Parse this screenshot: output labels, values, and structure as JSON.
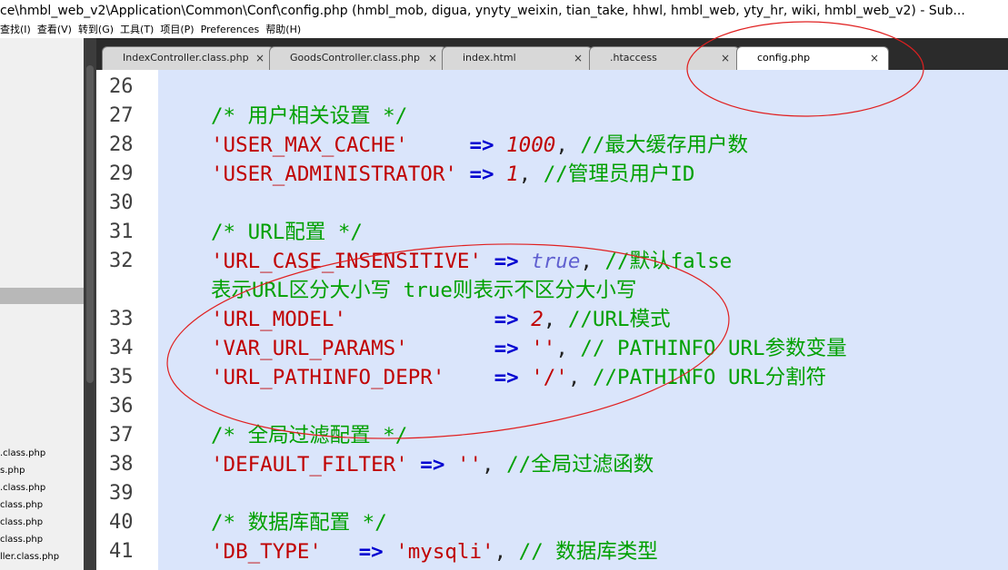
{
  "window": {
    "title": "ce\\hmbl_web_v2\\Application\\Common\\Conf\\config.php (hmbl_mob, digua, ynyty_weixin, tian_take, hhwl, hmbl_web, yty_hr, wiki, hmbl_web_v2) - Sub..."
  },
  "menu": [
    {
      "label": "查找(I)"
    },
    {
      "label": "查看(V)"
    },
    {
      "label": "转到(G)"
    },
    {
      "label": "工具(T)"
    },
    {
      "label": "项目(P)"
    },
    {
      "label": "Preferences"
    },
    {
      "label": "帮助(H)"
    }
  ],
  "sidebar": {
    "files": [
      {
        "name": ".class.php"
      },
      {
        "name": "s.php"
      },
      {
        "name": ".class.php"
      },
      {
        "name": "class.php"
      },
      {
        "name": "class.php"
      },
      {
        "name": "class.php"
      },
      {
        "name": "ller.class.php"
      }
    ]
  },
  "tabs": [
    {
      "label": "IndexController.class.php",
      "close": "×",
      "active": false
    },
    {
      "label": "GoodsController.class.php",
      "close": "×",
      "active": false
    },
    {
      "label": "index.html",
      "close": "×",
      "active": false
    },
    {
      "label": ".htaccess",
      "close": "×",
      "active": false
    },
    {
      "label": "config.php",
      "close": "×",
      "active": true
    }
  ],
  "editor": {
    "line_numbers": [
      "26",
      "27",
      "28",
      "29",
      "30",
      "31",
      "32",
      "",
      "33",
      "34",
      "35",
      "36",
      "37",
      "38",
      "39",
      "40",
      "41"
    ],
    "lines": [
      [],
      [
        {
          "t": "/* 用户相关设置 */",
          "c": "c-comment"
        }
      ],
      [
        {
          "t": "'USER_MAX_CACHE'",
          "c": "c-str"
        },
        {
          "t": "     ",
          "c": "c-plain"
        },
        {
          "t": "=>",
          "c": "c-op"
        },
        {
          "t": " ",
          "c": "c-plain"
        },
        {
          "t": "1000",
          "c": "c-num"
        },
        {
          "t": ", ",
          "c": "c-plain"
        },
        {
          "t": "//最大缓存用户数",
          "c": "c-comment"
        }
      ],
      [
        {
          "t": "'USER_ADMINISTRATOR'",
          "c": "c-str"
        },
        {
          "t": " ",
          "c": "c-plain"
        },
        {
          "t": "=>",
          "c": "c-op"
        },
        {
          "t": " ",
          "c": "c-plain"
        },
        {
          "t": "1",
          "c": "c-num"
        },
        {
          "t": ", ",
          "c": "c-plain"
        },
        {
          "t": "//管理员用户ID",
          "c": "c-comment"
        }
      ],
      [],
      [
        {
          "t": "/* URL配置 */",
          "c": "c-comment"
        }
      ],
      [
        {
          "t": "'URL_CASE_INSENSITIVE'",
          "c": "c-str"
        },
        {
          "t": " ",
          "c": "c-plain"
        },
        {
          "t": "=>",
          "c": "c-op"
        },
        {
          "t": " ",
          "c": "c-plain"
        },
        {
          "t": "true",
          "c": "c-true"
        },
        {
          "t": ", ",
          "c": "c-plain"
        },
        {
          "t": "//默认false",
          "c": "c-comment"
        }
      ],
      [
        {
          "t": "表示URL区分大小写 true则表示不区分大小写",
          "c": "c-comment"
        }
      ],
      [
        {
          "t": "'URL_MODEL'",
          "c": "c-str"
        },
        {
          "t": "            ",
          "c": "c-plain"
        },
        {
          "t": "=>",
          "c": "c-op"
        },
        {
          "t": " ",
          "c": "c-plain"
        },
        {
          "t": "2",
          "c": "c-num"
        },
        {
          "t": ", ",
          "c": "c-plain"
        },
        {
          "t": "//URL模式",
          "c": "c-comment"
        }
      ],
      [
        {
          "t": "'VAR_URL_PARAMS'",
          "c": "c-str"
        },
        {
          "t": "       ",
          "c": "c-plain"
        },
        {
          "t": "=>",
          "c": "c-op"
        },
        {
          "t": " ",
          "c": "c-plain"
        },
        {
          "t": "''",
          "c": "c-str"
        },
        {
          "t": ", ",
          "c": "c-plain"
        },
        {
          "t": "// PATHINFO URL参数变量",
          "c": "c-comment"
        }
      ],
      [
        {
          "t": "'URL_PATHINFO_DEPR'",
          "c": "c-str"
        },
        {
          "t": "    ",
          "c": "c-plain"
        },
        {
          "t": "=>",
          "c": "c-op"
        },
        {
          "t": " ",
          "c": "c-plain"
        },
        {
          "t": "'/'",
          "c": "c-str"
        },
        {
          "t": ", ",
          "c": "c-plain"
        },
        {
          "t": "//PATHINFO URL分割符",
          "c": "c-comment"
        }
      ],
      [],
      [
        {
          "t": "/* 全局过滤配置 */",
          "c": "c-comment"
        }
      ],
      [
        {
          "t": "'DEFAULT_FILTER'",
          "c": "c-str"
        },
        {
          "t": " ",
          "c": "c-plain"
        },
        {
          "t": "=>",
          "c": "c-op"
        },
        {
          "t": " ",
          "c": "c-plain"
        },
        {
          "t": "''",
          "c": "c-str"
        },
        {
          "t": ", ",
          "c": "c-plain"
        },
        {
          "t": "//全局过滤函数",
          "c": "c-comment"
        }
      ],
      [],
      [
        {
          "t": "/* 数据库配置 */",
          "c": "c-comment"
        }
      ],
      [
        {
          "t": "'DB_TYPE'",
          "c": "c-str"
        },
        {
          "t": "   ",
          "c": "c-plain"
        },
        {
          "t": "=>",
          "c": "c-op"
        },
        {
          "t": " ",
          "c": "c-plain"
        },
        {
          "t": "'mysqli'",
          "c": "c-str"
        },
        {
          "t": ", ",
          "c": "c-plain"
        },
        {
          "t": "// 数据库类型",
          "c": "c-comment"
        }
      ]
    ]
  },
  "colors": {
    "editor_bg": "#dae5fb",
    "comment": "#00a000",
    "string": "#c00000",
    "operator": "#0000d0",
    "annotation_ellipse": "#e02020"
  }
}
